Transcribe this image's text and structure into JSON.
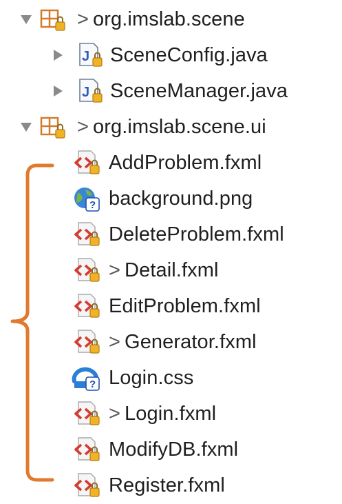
{
  "accent": {
    "bracket": "#e07a2e",
    "package_icon": "#d27c2a",
    "java_badge": "#2e5bb8",
    "xml_icon": "#d43b2f",
    "lock_badge": "#f0b328"
  },
  "tree": {
    "packages": [
      {
        "label": "org.imslab.scene",
        "prefix": ">",
        "icon": "package-icon",
        "expanded": true,
        "children": [
          {
            "label": "SceneConfig.java",
            "icon": "java-file-icon"
          },
          {
            "label": "SceneManager.java",
            "icon": "java-file-icon"
          }
        ]
      },
      {
        "label": "org.imslab.scene.ui",
        "prefix": ">",
        "icon": "package-icon",
        "expanded": true,
        "children": [
          {
            "label": "AddProblem.fxml",
            "prefix": "",
            "icon": "xml-file-icon"
          },
          {
            "label": "background.png",
            "prefix": "",
            "icon": "image-file-icon"
          },
          {
            "label": "DeleteProblem.fxml",
            "prefix": "",
            "icon": "xml-file-icon"
          },
          {
            "label": "Detail.fxml",
            "prefix": ">",
            "icon": "xml-file-icon"
          },
          {
            "label": "EditProblem.fxml",
            "prefix": "",
            "icon": "xml-file-icon"
          },
          {
            "label": "Generator.fxml",
            "prefix": ">",
            "icon": "xml-file-icon"
          },
          {
            "label": "Login.css",
            "prefix": "",
            "icon": "css-file-icon"
          },
          {
            "label": "Login.fxml",
            "prefix": ">",
            "icon": "xml-file-icon"
          },
          {
            "label": "ModifyDB.fxml",
            "prefix": "",
            "icon": "xml-file-icon"
          },
          {
            "label": "Register.fxml",
            "prefix": "",
            "icon": "xml-file-icon"
          }
        ]
      }
    ]
  }
}
